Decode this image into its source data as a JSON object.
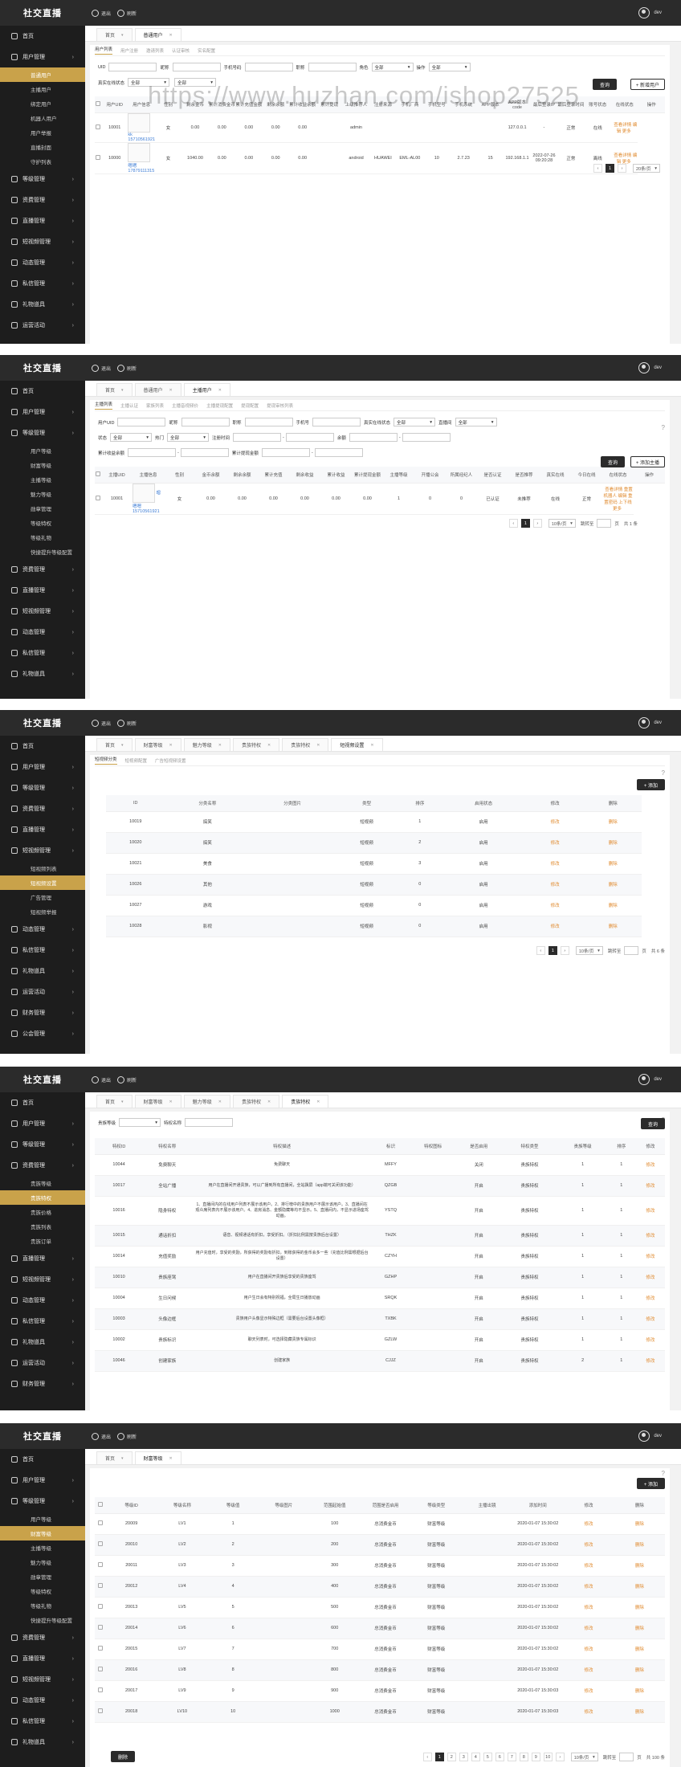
{
  "app": {
    "logo": "社交直播",
    "refresh": "退出",
    "clear": "刷新",
    "user": "dev"
  },
  "p1": {
    "sidebar": [
      {
        "label": "首页"
      },
      {
        "label": "用户管理",
        "subs": [
          "普通用户",
          "主播用户",
          "绑定用户",
          "机器人用户",
          "用户举报",
          "直播封面",
          "守护列表"
        ],
        "active": 0
      },
      {
        "label": "等级管理"
      },
      {
        "label": "资费管理"
      },
      {
        "label": "直播管理"
      },
      {
        "label": "短视频管理"
      },
      {
        "label": "动态管理"
      },
      {
        "label": "私信管理"
      },
      {
        "label": "礼物道具"
      },
      {
        "label": "运营活动"
      }
    ],
    "tabs": [
      "首页",
      "普通用户"
    ],
    "subnav": [
      "用户列表",
      "用户注册",
      "邀请列表",
      "认证审核",
      "实名配置"
    ],
    "filters1": [
      "UID",
      "昵称",
      "手机号码",
      "职称",
      "角色"
    ],
    "sel1": [
      "全部",
      "全部"
    ],
    "sel1_label": "操作",
    "filters2": [
      "真实在线状态",
      "全部",
      "全部"
    ],
    "btn_search": "查询",
    "btn_add": "+ 新增用户",
    "headers": [
      "用户UID",
      "用户信息",
      "性别",
      "剩余金币",
      "累计消费金币",
      "累计充值金额",
      "剩余余额",
      "累计收益余额",
      "累计提现",
      "上级推荐人",
      "注册来源",
      "手机厂商",
      "手机型号",
      "手机系统",
      "APP版本",
      "APP版本code",
      "最后登录IP",
      "最后登录时间",
      "账号状态",
      "在线状态",
      "操作"
    ],
    "rows": [
      {
        "uid": "10001",
        "name": "kk",
        "phone": "15710561921",
        "sex": "女",
        "c1": "0.00",
        "c2": "0.00",
        "c3": "0.00",
        "c4": "0.00",
        "c5": "0.00",
        "src": "admin",
        "brand": "",
        "model": "",
        "sys": "",
        "ver": "",
        "code": "",
        "ip": "127.0.0.1",
        "time": "-",
        "status": "正常",
        "online": "在线",
        "ops": "查看详情 编辑 更多"
      },
      {
        "uid": "10000",
        "name": "嗯嗯",
        "phone": "17879111315",
        "sex": "女",
        "c1": "1040.00",
        "c2": "0.00",
        "c3": "0.00",
        "c4": "0.00",
        "c5": "0.00",
        "src": "android",
        "brand": "HUAWEI",
        "model": "EML-AL00",
        "sys": "10",
        "ver": "2.7.23",
        "code": "15",
        "ip": "192.168.1.1",
        "time": "2022-07-26 09:20:28",
        "status": "正常",
        "online": "离线",
        "ops": "查看详情 编辑 更多"
      }
    ],
    "pager": {
      "page": "1",
      "size": "20条/页"
    }
  },
  "p2": {
    "sidebar": [
      {
        "label": "首页"
      },
      {
        "label": "用户管理"
      },
      {
        "label": "等级管理",
        "subs": [
          "用户等级",
          "财富等级",
          "主播等级",
          "魅力等级",
          "勋章管理",
          "等级特权",
          "等级礼物",
          "快捷提升等级配置"
        ],
        "active": -1
      },
      {
        "label": "资费管理"
      },
      {
        "label": "直播管理"
      },
      {
        "label": "短视频管理"
      },
      {
        "label": "动态管理"
      },
      {
        "label": "私信管理"
      },
      {
        "label": "礼物道具"
      }
    ],
    "tabs": [
      "首页",
      "普通用户",
      "主播用户"
    ],
    "subnav": [
      "主播列表",
      "主播认证",
      "家族列表",
      "主播音视频价",
      "主播提现配置",
      "提现配置",
      "提现审核列表"
    ],
    "filters1": [
      "用户UID",
      "昵称",
      "职称",
      "手机号",
      "真实在线状态",
      "全部",
      "直播间",
      "全部"
    ],
    "filters2": [
      "状态",
      "全部",
      "热门",
      "全部",
      "注册时间",
      "-",
      "余额",
      "-"
    ],
    "filters3": [
      "累计收益余额",
      "-",
      "累计提现金额",
      "-"
    ],
    "btn_search": "查询",
    "btn_add": "+ 添加主播",
    "headers": [
      "主播UID",
      "主播信息",
      "性别",
      "金币余额",
      "剩余余额",
      "累计充值",
      "剩余收益",
      "累计收益",
      "累计提现金额",
      "主播等级",
      "开播公会",
      "所属经纪人",
      "是否认证",
      "是否推荐",
      "真实在线",
      "今日在线",
      "在线状态",
      "操作"
    ],
    "row": {
      "uid": "10001",
      "name": "嗯嗯嗯",
      "phone": "15710561921",
      "sex": "女",
      "v1": "0.00",
      "v2": "0.00",
      "v3": "0.00",
      "v4": "0.00",
      "v5": "0.00",
      "v6": "0.00",
      "lv": "1",
      "g": "0",
      "a": "0",
      "auth": "已认证",
      "rec": "未推荐",
      "real": "在线",
      "stat": "正常",
      "ops": "查看详情 重置机器人 编辑 重置密码 上下线 更多"
    },
    "pager": {
      "page": "1",
      "size": "10条/页",
      "goto": "跳转至",
      "total": "共 1 条"
    }
  },
  "p3": {
    "sidebar": [
      {
        "label": "首页"
      },
      {
        "label": "用户管理"
      },
      {
        "label": "等级管理"
      },
      {
        "label": "资费管理"
      },
      {
        "label": "直播管理"
      },
      {
        "label": "短视频管理",
        "subs": [
          "短视频列表",
          "短视频设置",
          "广告管理",
          "短视频举报"
        ],
        "active": 1
      },
      {
        "label": "动态管理"
      },
      {
        "label": "私信管理"
      },
      {
        "label": "礼物道具"
      },
      {
        "label": "运营活动"
      },
      {
        "label": "财务管理"
      },
      {
        "label": "公会管理"
      }
    ],
    "tabs": [
      "首页",
      "财富等级",
      "魅力等级",
      "贵族特权",
      "贵族特权",
      "短视频设置"
    ],
    "subnav": [
      "短视频分类",
      "短视频配置",
      "广告短视频设置"
    ],
    "btn_add": "+ 添加",
    "headers": [
      "ID",
      "分类名称",
      "分类图片",
      "类型",
      "排序",
      "启用状态",
      "修改",
      "删除"
    ],
    "rows": [
      [
        "10019",
        "搞笑",
        "",
        "短视频",
        "1",
        "启用"
      ],
      [
        "10020",
        "搞笑",
        "",
        "短视频",
        "2",
        "启用"
      ],
      [
        "10021",
        "美食",
        "",
        "短视频",
        "3",
        "启用"
      ],
      [
        "10026",
        "其他",
        "",
        "短视频",
        "0",
        "启用"
      ],
      [
        "10027",
        "游戏",
        "",
        "短视频",
        "0",
        "启用"
      ],
      [
        "10028",
        "影视",
        "",
        "短视频",
        "0",
        "启用"
      ]
    ],
    "edit": "修改",
    "del": "删除",
    "pager": {
      "page": "1",
      "size": "10条/页",
      "goto": "跳转至",
      "total": "共 6 条"
    }
  },
  "p4": {
    "sidebar": [
      {
        "label": "首页"
      },
      {
        "label": "用户管理"
      },
      {
        "label": "等级管理"
      },
      {
        "label": "资费管理",
        "subs": [
          "贵族等级",
          "贵族特权",
          "贵族价格",
          "贵族列表",
          "贵族订单"
        ],
        "active": 1
      },
      {
        "label": "直播管理"
      },
      {
        "label": "短视频管理"
      },
      {
        "label": "动态管理"
      },
      {
        "label": "私信管理"
      },
      {
        "label": "礼物道具"
      },
      {
        "label": "运营活动"
      },
      {
        "label": "财务管理"
      }
    ],
    "tabs": [
      "首页",
      "财富等级",
      "魅力等级",
      "贵族特权",
      "贵族特权"
    ],
    "filters": [
      "贵族等级",
      "特权名称"
    ],
    "btn_search": "查询",
    "headers": [
      "特权ID",
      "特权名称",
      "特权描述",
      "标识",
      "特权图标",
      "是否启用",
      "特权类型",
      "贵族等级",
      "排序",
      "修改"
    ],
    "rows": [
      [
        "10044",
        "免费聊天",
        "免费聊天",
        "MFFY",
        "",
        "关闭",
        "贵族特权",
        "1",
        "1"
      ],
      [
        "10017",
        "全站广播",
        "用户在直播间开通贵族，可以广播到所有直播间，全站飘屏（app端可关闭该功能）",
        "QZGB",
        "",
        "开启",
        "贵族特权",
        "1",
        "1"
      ],
      [
        "10016",
        "隐身特权",
        "1、直播间内的在线用户列表不展示该用户。2、排行榜中的贵族用户不展示该用户。3、直播间在观众席列表内不展示该用户。4、进房消息、金额隐藏等均不显示。5、直播间内，不显示进场座驾动画。",
        "YSTQ",
        "",
        "开启",
        "贵族特权",
        "1",
        "1"
      ],
      [
        "10015",
        "通话折扣",
        "语音、视频通话有折扣，享受折扣。（折扣比例需按贵族后台设置）",
        "THZK",
        "",
        "开启",
        "贵族特权",
        "1",
        "1"
      ],
      [
        "10014",
        "充值奖励",
        "用户充值时，享受的奖励，所获得的奖励有折扣，到账获得的金币会多一些（充值比例需根据后台设置）",
        "CZYH",
        "",
        "开启",
        "贵族特权",
        "1",
        "1"
      ],
      [
        "10010",
        "贵族座驾",
        "用户在直播间开贵族后享受的贵族座驾",
        "GZHP",
        "",
        "开启",
        "贵族特权",
        "1",
        "1"
      ],
      [
        "10004",
        "生日问候",
        "用户生日会有特别祝福，全局生日播放动画",
        "SRQK",
        "",
        "开启",
        "贵族特权",
        "1",
        "1"
      ],
      [
        "10003",
        "头像边框",
        "贵族用户头像显示特殊边框（需要后台设置头像框）",
        "TXBK",
        "",
        "开启",
        "贵族特权",
        "1",
        "1"
      ],
      [
        "10002",
        "贵族标识",
        "聊天列表时，可选择隐藏贵族专属标识",
        "GZLW",
        "",
        "开启",
        "贵族特权",
        "1",
        "1"
      ],
      [
        "10046",
        "创建家族",
        "创建家族",
        "CJJZ",
        "",
        "开启",
        "贵族特权",
        "2",
        "1"
      ]
    ],
    "edit": "修改"
  },
  "p5": {
    "sidebar": [
      {
        "label": "首页"
      },
      {
        "label": "用户管理"
      },
      {
        "label": "等级管理",
        "subs": [
          "用户等级",
          "财富等级",
          "主播等级",
          "魅力等级",
          "勋章管理",
          "等级特权",
          "等级礼物",
          "快捷提升等级配置"
        ],
        "active": 1
      },
      {
        "label": "资费管理"
      },
      {
        "label": "直播管理"
      },
      {
        "label": "短视频管理"
      },
      {
        "label": "动态管理"
      },
      {
        "label": "私信管理"
      },
      {
        "label": "礼物道具"
      }
    ],
    "tabs": [
      "首页",
      "财富等级"
    ],
    "btn_add": "+ 添加",
    "headers": [
      "等级ID",
      "等级名称",
      "等级值",
      "等级图片",
      "范围起始值",
      "范围是否启用",
      "等级类型",
      "主播出镜",
      "添加时间",
      "修改",
      "删除"
    ],
    "rows": [
      [
        "20009",
        "LV1",
        "1",
        "",
        "100",
        "总消费金币",
        "财富等级",
        "",
        "2020-01-07 15:30:02"
      ],
      [
        "20010",
        "LV2",
        "2",
        "",
        "200",
        "总消费金币",
        "财富等级",
        "",
        "2020-01-07 15:30:02"
      ],
      [
        "20011",
        "LV3",
        "3",
        "",
        "300",
        "总消费金币",
        "财富等级",
        "",
        "2020-01-07 15:30:02"
      ],
      [
        "20012",
        "LV4",
        "4",
        "",
        "400",
        "总消费金币",
        "财富等级",
        "",
        "2020-01-07 15:30:02"
      ],
      [
        "20013",
        "LV5",
        "5",
        "",
        "500",
        "总消费金币",
        "财富等级",
        "",
        "2020-01-07 15:30:02"
      ],
      [
        "20014",
        "LV6",
        "6",
        "",
        "600",
        "总消费金币",
        "财富等级",
        "",
        "2020-01-07 15:30:02"
      ],
      [
        "20015",
        "LV7",
        "7",
        "",
        "700",
        "总消费金币",
        "财富等级",
        "",
        "2020-01-07 15:30:02"
      ],
      [
        "20016",
        "LV8",
        "8",
        "",
        "800",
        "总消费金币",
        "财富等级",
        "",
        "2020-01-07 15:30:02"
      ],
      [
        "20017",
        "LV9",
        "9",
        "",
        "900",
        "总消费金币",
        "财富等级",
        "",
        "2020-01-07 15:30:03"
      ],
      [
        "20018",
        "LV10",
        "10",
        "",
        "1000",
        "总消费金币",
        "财富等级",
        "",
        "2020-01-07 15:30:03"
      ]
    ],
    "edit": "修改",
    "del": "删除",
    "btn_delete": "删除",
    "pager": {
      "pages": [
        "1",
        "2",
        "3",
        "4",
        "5",
        "6",
        "7",
        "8",
        "9",
        "10"
      ],
      "size": "10条/页",
      "goto": "跳转至",
      "total": "共 100 条"
    }
  },
  "watermark": "https://www.huzhan.com/ishop27525"
}
